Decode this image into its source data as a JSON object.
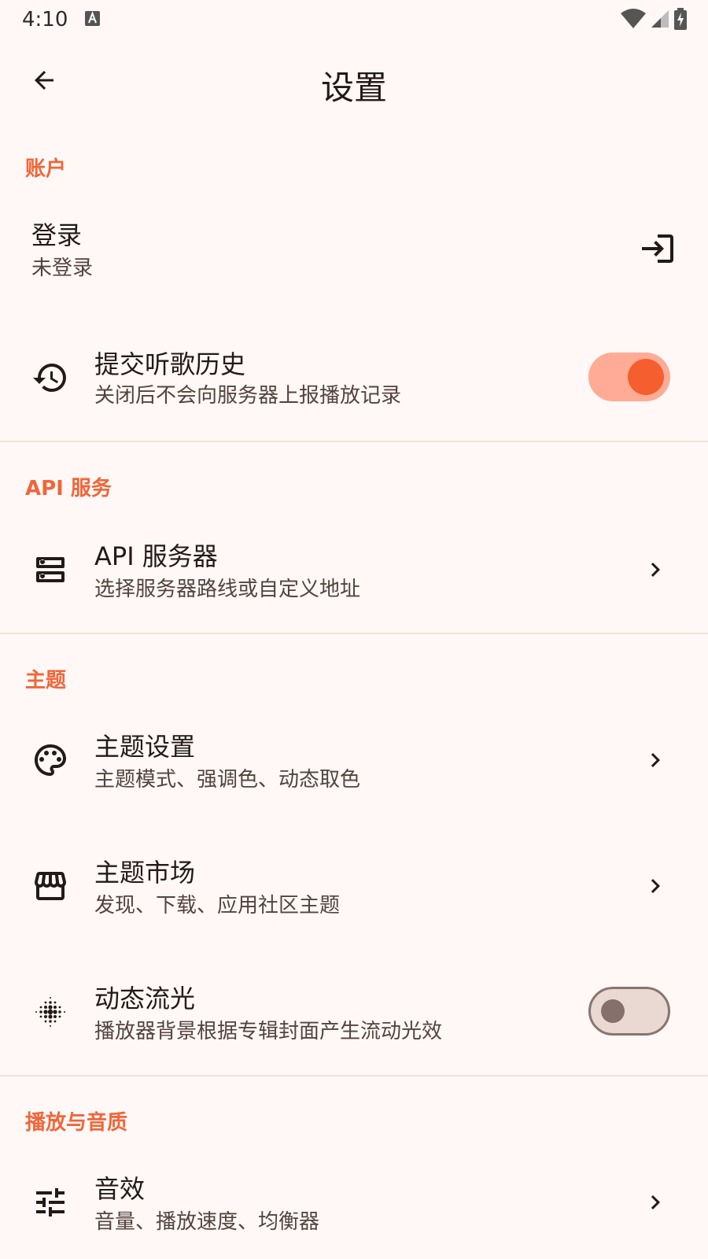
{
  "status": {
    "time": "4:10"
  },
  "header": {
    "title": "设置"
  },
  "sections": {
    "account": {
      "header": "账户",
      "login": {
        "title": "登录",
        "subtitle": "未登录"
      },
      "history": {
        "title": "提交听歌历史",
        "subtitle": "关闭后不会向服务器上报播放记录",
        "enabled": true
      }
    },
    "api": {
      "header": "API 服务",
      "server": {
        "title": "API 服务器",
        "subtitle": "选择服务器路线或自定义地址"
      }
    },
    "theme": {
      "header": "主题",
      "settings": {
        "title": "主题设置",
        "subtitle": "主题模式、强调色、动态取色"
      },
      "market": {
        "title": "主题市场",
        "subtitle": "发现、下载、应用社区主题"
      },
      "flow": {
        "title": "动态流光",
        "subtitle": "播放器背景根据专辑封面产生流动光效",
        "enabled": false
      }
    },
    "playback": {
      "header": "播放与音质",
      "effects": {
        "title": "音效",
        "subtitle": "音量、播放速度、均衡器"
      }
    }
  },
  "colors": {
    "accent": "#F0663A",
    "background": "#FFF8F6",
    "switch_on_track": "#FFAB96",
    "switch_on_thumb": "#F55E2E"
  }
}
